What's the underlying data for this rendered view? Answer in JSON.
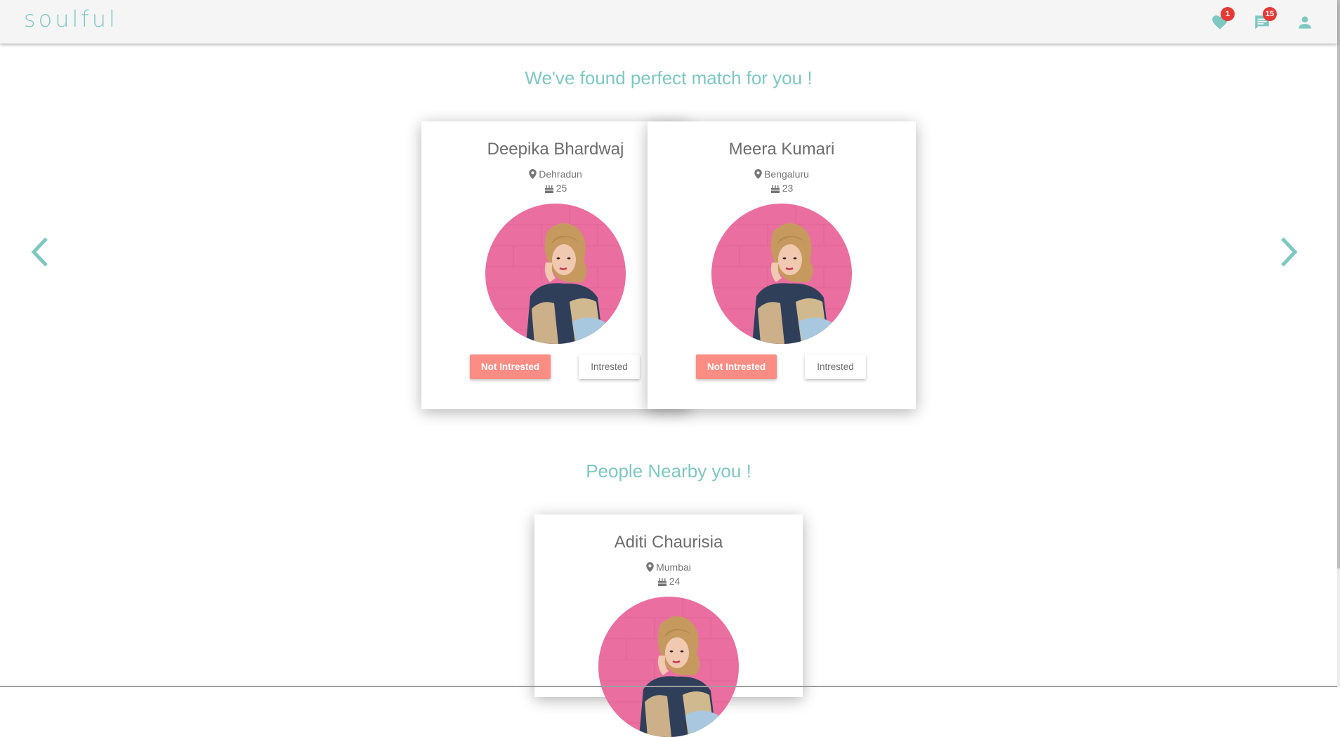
{
  "app": {
    "brand": "soulful"
  },
  "nav": {
    "likes_icon": "heart-icon",
    "likes_badge": "1",
    "messages_icon": "chat-icon",
    "messages_badge": "15",
    "profile_icon": "person-icon"
  },
  "colors": {
    "accent": "#7ec8c2",
    "not_interested": "#fc8d84",
    "badge": "#e53935",
    "navbar_bg": "#f5f5f5"
  },
  "matches": {
    "title": "We've found perfect match for you !",
    "cards": [
      {
        "name": "Deepika Bhardwaj",
        "location": "Dehradun",
        "age": "25",
        "btn_no": "Not Intrested",
        "btn_yes": "Intrested"
      },
      {
        "name": "Meera Kumari",
        "location": "Bengaluru",
        "age": "23",
        "btn_no": "Not Intrested",
        "btn_yes": "Intrested"
      }
    ]
  },
  "nearby": {
    "title": "People Nearby you !",
    "cards": [
      {
        "name": "Aditi Chaurisia",
        "location": "Mumbai",
        "age": "24"
      }
    ]
  }
}
